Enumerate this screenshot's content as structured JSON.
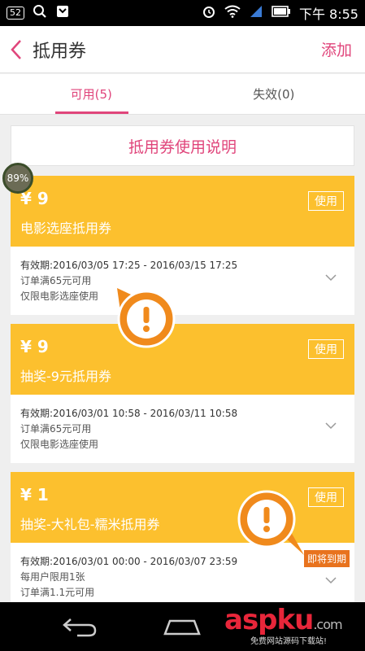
{
  "status_bar": {
    "notification_count": "52",
    "time": "下午 8:55"
  },
  "header": {
    "title": "抵用券",
    "add_label": "添加"
  },
  "tabs": [
    {
      "label": "可用(5)",
      "active": true
    },
    {
      "label": "失效(0)",
      "active": false
    }
  ],
  "instructions_label": "抵用券使用说明",
  "progress_label": "89%",
  "coupons": [
    {
      "amount": "¥ 9",
      "name": "电影选座抵用券",
      "use_label": "使用",
      "validity": "有效期:2016/03/05 17:25 - 2016/03/15 17:25",
      "rule1": "订单满65元可用",
      "rule2": "仅限电影选座使用"
    },
    {
      "amount": "¥ 9",
      "name": "抽奖-9元抵用券",
      "use_label": "使用",
      "validity": "有效期:2016/03/01 10:58 - 2016/03/11 10:58",
      "rule1": "订单满65元可用",
      "rule2": "仅限电影选座使用"
    },
    {
      "amount": "¥ 1",
      "name": "抽奖-大礼包-糯米抵用券",
      "use_label": "使用",
      "validity": "有效期:2016/03/01 00:00 - 2016/03/07 23:59",
      "rule1": "每用户限用1张",
      "rule2": "订单满1.1元可用"
    }
  ],
  "expiring_label": "即将到期",
  "watermark": {
    "logo": "aspku",
    "domain": ".com",
    "caption": "免费网站源码下载站!"
  },
  "colors": {
    "accent": "#e0457b",
    "coupon": "#fcc02e",
    "alert": "#f08a1c"
  }
}
